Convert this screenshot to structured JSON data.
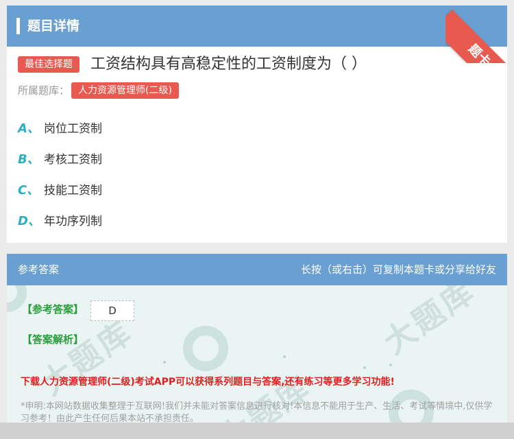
{
  "header": {
    "title": "题目详情",
    "corner_label": "题卡"
  },
  "question": {
    "type_tag": "最佳选择题",
    "text": "工资结构具有高稳定性的工资制度为（  ）",
    "bank_label": "所属题库：",
    "bank_name": "人力资源管理师(二级)"
  },
  "options": [
    {
      "letter": "A、",
      "text": "岗位工资制"
    },
    {
      "letter": "B、",
      "text": "考核工资制"
    },
    {
      "letter": "C、",
      "text": "技能工资制"
    },
    {
      "letter": "D、",
      "text": "年功序列制"
    }
  ],
  "answer_section": {
    "title": "参考答案",
    "hint": "长按（或右击）可复制本题卡或分享给好友",
    "answer_label": "【参考答案】",
    "answer_value": "D",
    "analysis_label": "【答案解析】",
    "promo": "下载人力资源管理师(二级)考试APP可以获得系列题目与答案,还有练习等更多学习功能!",
    "disclaimer": "*申明:本网站数据收集整理于互联网!我们并未能对答案信息进行核对!本信息不能用于生产、生活、考试等情境中,仅供学习参考！由此产生任何后果本站不承担责任。"
  },
  "colors": {
    "header_bg": "#6a9fd1",
    "accent_red": "#e85a4f",
    "option_letter": "#2bb0c2",
    "answer_green": "#2a9d3d",
    "promo_red": "#e02020"
  }
}
